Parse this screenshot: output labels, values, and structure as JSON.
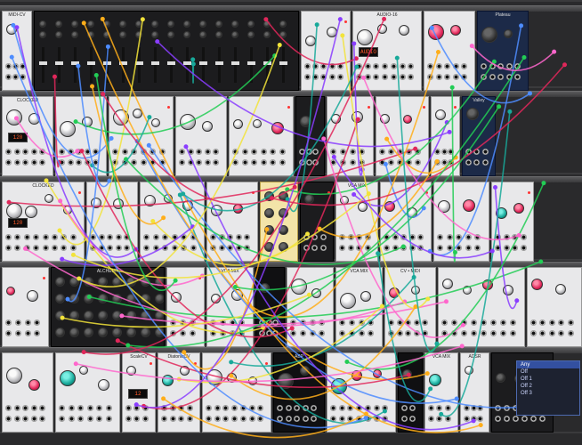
{
  "rows": [
    {
      "modules": [
        {
          "title": "MIDI-CV",
          "style": "light",
          "w": 36
        },
        {
          "title": "",
          "style": "dark",
          "w": 300
        },
        {
          "title": "",
          "style": "light",
          "w": 58
        },
        {
          "title": "AUDIO-16",
          "style": "light",
          "w": 80
        },
        {
          "title": "",
          "style": "light",
          "w": 60
        },
        {
          "title": "Plateau",
          "style": "navy",
          "w": 60
        }
      ]
    },
    {
      "modules": [
        {
          "title": "CLOCKED",
          "style": "light",
          "w": 60
        },
        {
          "title": "",
          "style": "light",
          "w": 60
        },
        {
          "title": "",
          "style": "light",
          "w": 75
        },
        {
          "title": "",
          "style": "light",
          "w": 60
        },
        {
          "title": "",
          "style": "light",
          "w": 75
        },
        {
          "title": "",
          "style": "dark",
          "w": 35
        },
        {
          "title": "",
          "style": "light",
          "w": 55
        },
        {
          "title": "",
          "style": "light",
          "w": 62
        },
        {
          "title": "",
          "style": "light",
          "w": 35
        },
        {
          "title": "Valley",
          "style": "navy",
          "w": 40
        }
      ]
    },
    {
      "modules": [
        {
          "title": "CLOCKED",
          "style": "light",
          "w": 95
        },
        {
          "title": "",
          "style": "light",
          "w": 60
        },
        {
          "title": "",
          "style": "light",
          "w": 75
        },
        {
          "title": "",
          "style": "light",
          "w": 60
        },
        {
          "title": "",
          "style": "gold",
          "w": 45
        },
        {
          "title": "",
          "style": "dark",
          "w": 40
        },
        {
          "title": "VCA MIX",
          "style": "light",
          "w": 50
        },
        {
          "title": "",
          "style": "light",
          "w": 60
        },
        {
          "title": "",
          "style": "light",
          "w": 65
        },
        {
          "title": "",
          "style": "light",
          "w": 50
        }
      ]
    },
    {
      "modules": [
        {
          "title": "",
          "style": "light",
          "w": 55
        },
        {
          "title": "ALCHEMY",
          "style": "dark",
          "w": 130
        },
        {
          "title": "",
          "style": "light",
          "w": 45
        },
        {
          "title": "VCA MIX",
          "style": "light",
          "w": 55
        },
        {
          "title": "",
          "style": "black",
          "w": 35
        },
        {
          "title": "",
          "style": "light",
          "w": 55
        },
        {
          "title": "VCA MIX",
          "style": "light",
          "w": 55
        },
        {
          "title": "CV • MIDI",
          "style": "light",
          "w": 60
        },
        {
          "title": "",
          "style": "light",
          "w": 100
        },
        {
          "title": "",
          "style": "light",
          "w": 64
        }
      ]
    },
    {
      "modules": [
        {
          "title": "",
          "style": "light",
          "w": 60
        },
        {
          "title": "",
          "style": "light",
          "w": 75
        },
        {
          "title": "ScaleCV",
          "style": "light",
          "w": 40
        },
        {
          "title": "DiatonicCV",
          "style": "light",
          "w": 50
        },
        {
          "title": "",
          "style": "light",
          "w": 80
        },
        {
          "title": "ABP",
          "style": "black",
          "w": 60
        },
        {
          "title": "",
          "style": "light",
          "w": 80
        },
        {
          "title": "",
          "style": "black",
          "w": 30
        },
        {
          "title": "VCA MIX",
          "style": "light",
          "w": 40
        },
        {
          "title": "ADSR",
          "style": "light",
          "w": 35
        },
        {
          "title": "",
          "style": "dark",
          "w": 72
        }
      ]
    }
  ],
  "menu": {
    "items": [
      "Any",
      "Off",
      "Off 1",
      "Off 2",
      "Off 3"
    ],
    "active_index": 0
  },
  "cable_colors": [
    "#e0275a",
    "#18a99a",
    "#ffae1a",
    "#4d8cff",
    "#8a3dff",
    "#22cc55",
    "#ff66cc",
    "#f2e33a"
  ],
  "screens": {
    "clock1": "120",
    "clock2": "120",
    "seq": "12",
    "audio": "AUDIO"
  }
}
